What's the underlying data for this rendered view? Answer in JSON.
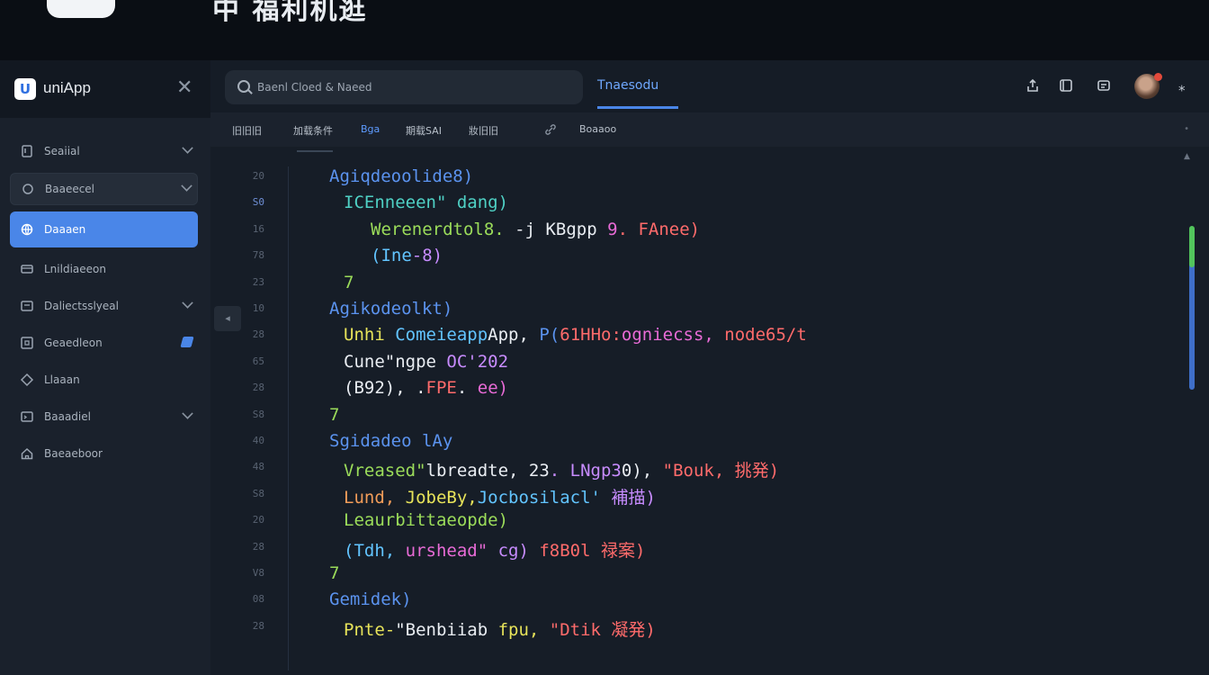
{
  "banner": {
    "title": "中 福利机逛"
  },
  "sidebar": {
    "app_name": "uniApp",
    "logo_letter": "U",
    "items": [
      {
        "label": "Seaiial",
        "icon": "page-icon",
        "chevron": true
      },
      {
        "label": "Baaeecel",
        "icon": "circle-icon",
        "chevron": true
      },
      {
        "label": "Daaaen",
        "icon": "globe-icon",
        "active": true
      },
      {
        "label": "Lnildiaeeon",
        "icon": "card-icon"
      },
      {
        "label": "Daliectsslyeal",
        "icon": "window-icon",
        "chevron": true
      },
      {
        "label": "Geaedleon",
        "icon": "grid-icon",
        "badge": true
      },
      {
        "label": "Llaaan",
        "icon": "diamond-icon"
      },
      {
        "label": "Baaadiel",
        "icon": "terminal-icon",
        "chevron": true
      },
      {
        "label": "Baeaeboor",
        "icon": "home-icon"
      }
    ]
  },
  "topbar": {
    "search_placeholder": "Baenl Cloed & Naeed",
    "active_tab": "Tnaesodu"
  },
  "subbar": {
    "items": [
      "旧旧旧",
      "加载条件",
      "Bga",
      "期载SAI",
      "妝旧旧",
      "Boaaoo"
    ],
    "highlight_index": 2
  },
  "editor": {
    "line_numbers": [
      "20",
      "S0",
      "16",
      "78",
      "23",
      "10",
      "28",
      "65",
      "28",
      "S8",
      "40",
      "48",
      "S8",
      "20",
      "28",
      "V8",
      "08",
      "28"
    ],
    "current_line_index": 1,
    "lines": [
      {
        "indent": 1,
        "tokens": [
          {
            "t": "Agiqdeoolide8)",
            "c": "blue"
          }
        ]
      },
      {
        "indent": 2,
        "tokens": [
          {
            "t": "ICEnneeen\" dang)",
            "c": "teal"
          }
        ]
      },
      {
        "indent": 3,
        "tokens": [
          {
            "t": "Werenerdtol8. ",
            "c": "green"
          },
          {
            "t": "-j ",
            "c": "white"
          },
          {
            "t": "KBgpp ",
            "c": "white"
          },
          {
            "t": "9",
            "c": "pink"
          },
          {
            "t": ". FAnee)",
            "c": "red"
          }
        ]
      },
      {
        "indent": 3,
        "tokens": [
          {
            "t": "(Ine",
            "c": "cyan"
          },
          {
            "t": "-8)",
            "c": "violet"
          }
        ]
      },
      {
        "indent": 2,
        "tokens": [
          {
            "t": "7",
            "c": "green"
          }
        ]
      },
      {
        "indent": 1,
        "tokens": [
          {
            "t": "Agikodeolkt)",
            "c": "blue"
          }
        ]
      },
      {
        "indent": 2,
        "tokens": [
          {
            "t": "Unhi ",
            "c": "yellow"
          },
          {
            "t": "Comeieapp",
            "c": "cyan"
          },
          {
            "t": "App, ",
            "c": "white"
          },
          {
            "t": "P(",
            "c": "blue"
          },
          {
            "t": "61HHo:",
            "c": "red"
          },
          {
            "t": "ogniecss, ",
            "c": "pink"
          },
          {
            "t": "node65/t",
            "c": "red"
          }
        ]
      },
      {
        "indent": 2,
        "tokens": [
          {
            "t": "Cune\"ngpe ",
            "c": "white"
          },
          {
            "t": "OC'202",
            "c": "violet"
          }
        ]
      },
      {
        "indent": 2,
        "tokens": [
          {
            "t": "(B92)",
            "c": "white"
          },
          {
            "t": ", .",
            "c": "white"
          },
          {
            "t": "FPE",
            "c": "red"
          },
          {
            "t": ". ",
            "c": "white"
          },
          {
            "t": "ee)",
            "c": "pink"
          }
        ]
      },
      {
        "indent": 1,
        "tokens": [
          {
            "t": "7",
            "c": "green"
          }
        ]
      },
      {
        "indent": 1,
        "tokens": [
          {
            "t": "Sgidadeo lAy",
            "c": "blue"
          }
        ]
      },
      {
        "indent": 2,
        "tokens": [
          {
            "t": "Vreased\"",
            "c": "green"
          },
          {
            "t": "lbreadte, ",
            "c": "white"
          },
          {
            "t": "23",
            "c": "white"
          },
          {
            "t": ". LNgp3",
            "c": "violet"
          },
          {
            "t": "0), ",
            "c": "white"
          },
          {
            "t": "\"Bouk, 挑発)",
            "c": "red"
          }
        ]
      },
      {
        "indent": 2,
        "tokens": [
          {
            "t": "Lund, ",
            "c": "orange"
          },
          {
            "t": "JobeBy,",
            "c": "yellow"
          },
          {
            "t": "Jocbosilacl' ",
            "c": "cyan"
          },
          {
            "t": "補描)",
            "c": "violet"
          }
        ]
      },
      {
        "indent": 2,
        "tokens": [
          {
            "t": "Leaurbittaeopde)",
            "c": "green"
          }
        ]
      },
      {
        "indent": 2,
        "tokens": [
          {
            "t": "(Tdh, ",
            "c": "cyan"
          },
          {
            "t": "urshead\" ",
            "c": "pink"
          },
          {
            "t": "cg) ",
            "c": "violet"
          },
          {
            "t": "f8B0l 禄案)",
            "c": "red"
          }
        ]
      },
      {
        "indent": 1,
        "tokens": [
          {
            "t": "7",
            "c": "green"
          }
        ]
      },
      {
        "indent": 1,
        "tokens": [
          {
            "t": "Gemidek)",
            "c": "blue"
          }
        ]
      },
      {
        "indent": 2,
        "tokens": [
          {
            "t": "Pnte-",
            "c": "yellow"
          },
          {
            "t": "\"Benbiiab ",
            "c": "white"
          },
          {
            "t": "fpu, ",
            "c": "yellow"
          },
          {
            "t": "\"Dtik 凝発)",
            "c": "red"
          }
        ]
      }
    ]
  },
  "colors": {
    "accent": "#4a86e8",
    "sidebar_bg": "#1a212c",
    "editor_bg": "#161d27",
    "scroll_green": "#52c45c"
  }
}
